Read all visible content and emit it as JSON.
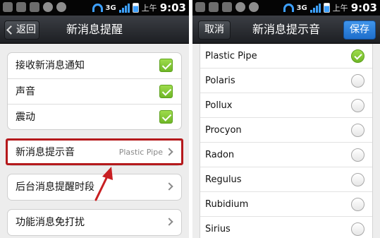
{
  "left": {
    "status": {
      "network": "3G",
      "ampm": "上午",
      "time": "9:03"
    },
    "header": {
      "back_label": "返回",
      "title": "新消息提醒"
    },
    "toggles": [
      {
        "label": "接收新消息通知",
        "checked": true
      },
      {
        "label": "声音",
        "checked": true
      },
      {
        "label": "震动",
        "checked": true
      }
    ],
    "tone_row": {
      "label": "新消息提示音",
      "value": "Plastic Pipe"
    },
    "quiet_hours_label": "后台消息提醒时段",
    "dnd_label": "功能消息免打扰"
  },
  "right": {
    "status": {
      "network": "3G",
      "ampm": "上午",
      "time": "9:03"
    },
    "header": {
      "cancel_label": "取消",
      "title": "新消息提示音",
      "save_label": "保存"
    },
    "tones": [
      {
        "name": "Plastic Pipe",
        "selected": true
      },
      {
        "name": "Polaris",
        "selected": false
      },
      {
        "name": "Pollux",
        "selected": false
      },
      {
        "name": "Procyon",
        "selected": false
      },
      {
        "name": "Radon",
        "selected": false
      },
      {
        "name": "Regulus",
        "selected": false
      },
      {
        "name": "Rubidium",
        "selected": false
      },
      {
        "name": "Sirius",
        "selected": false
      }
    ]
  },
  "colors": {
    "checkbox_green": "#7cc52f",
    "highlight_red": "#b5191c",
    "save_blue": "#2f84dd",
    "titlebar_dark": "#2b2e33"
  },
  "icons": [
    "back-arrow-icon",
    "checkmark-icon",
    "chevron-right-icon",
    "radio-selected-icon",
    "radio-empty-icon",
    "wifi-icon",
    "signal-icon",
    "battery-icon",
    "annotation-arrow-icon"
  ]
}
